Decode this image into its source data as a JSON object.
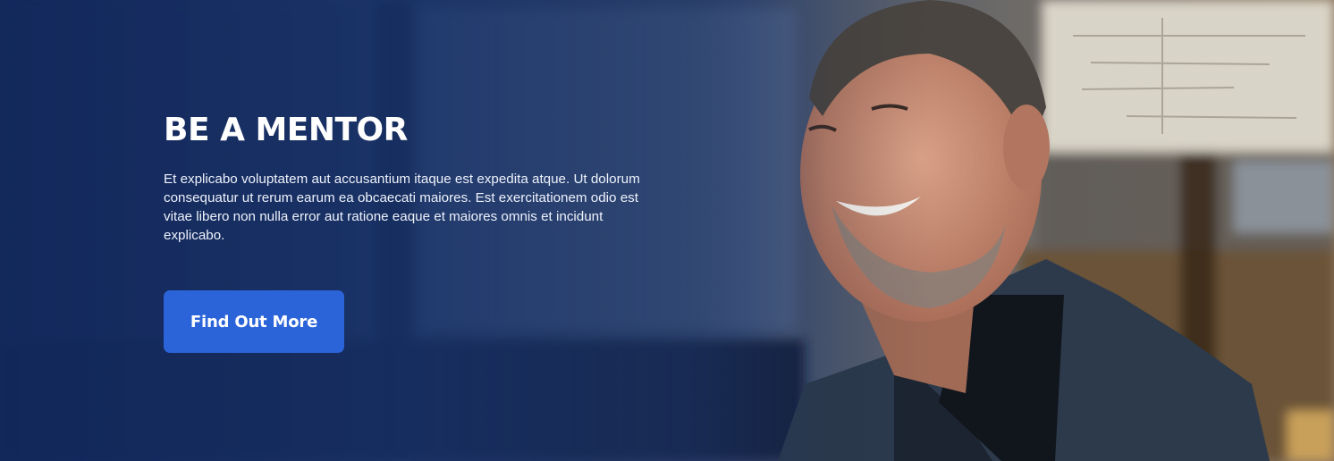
{
  "hero": {
    "title": "BE A MENTOR",
    "description": "Et explicabo voluptatem aut accusantium itaque est expedita atque. Ut dolorum consequatur ut rerum earum ea obcaecati maiores. Est exercitationem odio est vitae libero non nulla error aut ratione eaque et maiores omnis et incidunt explicabo.",
    "cta_label": "Find Out More"
  },
  "colors": {
    "overlay": "#1b3268",
    "cta_background": "#2b63d8",
    "text": "#ffffff"
  }
}
